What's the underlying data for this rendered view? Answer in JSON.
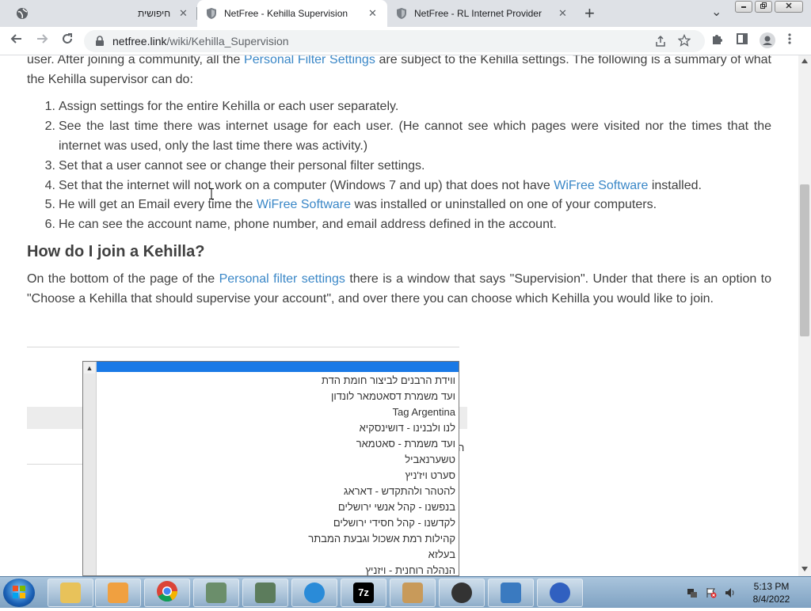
{
  "browser": {
    "tabs": [
      {
        "title": "חיפושית",
        "active": false
      },
      {
        "title": "NetFree - Kehilla Supervision",
        "active": true
      },
      {
        "title": "NetFree - RL Internet Provider",
        "active": false
      }
    ],
    "close_glyph": "✕",
    "new_tab_glyph": "+",
    "tab_search_glyph": "⌄",
    "url_host": "netfree.link",
    "url_path": "/wiki/Kehilla_Supervision"
  },
  "article": {
    "intro_p1": "user. After joining a community, all the ",
    "intro_link": "Personal Filter Settings",
    "intro_p2": " are subject to the Kehilla settings. The following is a summary of what the Kehilla supervisor can do:",
    "list": [
      {
        "num": "1.",
        "pre": "Assign settings for the entire Kehilla or each user separately.",
        "link": "",
        "post": ""
      },
      {
        "num": "2.",
        "pre": "See the last time there was internet usage for each user. (He cannot see which pages were visited nor the times that the internet was used, only the last time there was activity.)",
        "link": "",
        "post": ""
      },
      {
        "num": "3.",
        "pre": "Set that a user cannot see or change their personal filter settings.",
        "link": "",
        "post": ""
      },
      {
        "num": "4.",
        "pre": "Set that the internet will not work on a computer (Windows 7 and up) that does not have ",
        "link": "WiFree Software",
        "post": " installed."
      },
      {
        "num": "5.",
        "pre": "He will get an Email every time the ",
        "link": "WiFree Software",
        "post": " was installed or uninstalled on one of your computers."
      },
      {
        "num": "6.",
        "pre": "He can see the account name, phone number, and email address defined in the account.",
        "link": "",
        "post": ""
      }
    ],
    "heading": "How do I join a Kehilla?",
    "join_p1": "On the bottom of the page of the ",
    "join_link": "Personal filter settings",
    "join_p2": " there is a window that says \"Supervision\". Under that there is an option to \"Choose a Kehilla that should supervise your account\", and over there you can choose which Kehilla you would like to join."
  },
  "listbox": {
    "scroll_up_glyph": "▲",
    "items": [
      "ווידת הרבנים לביצור חומת הדת",
      "ועד משמרת דסאטמאר לונדון",
      "Tag Argentina",
      "לנו ולבנינו - דושינסקיא",
      "ועד משמרת - סאטמאר",
      "טשערנאביל",
      "סערט ויז'ניץ",
      "להטהר ולהתקדש - דאראג",
      "בנפשנו - קהל אנשי ירושלים",
      "לקדשנו - קהל חסידי ירושלים",
      "קהילות רמת אשכול וגבעת המבתר",
      "בעלזא",
      "הנהלה רוחנית - ויזניץ"
    ],
    "side_char": "ה"
  },
  "taskbar": {
    "time": "5:13 PM",
    "date": "8/4/2022",
    "apps": [
      "file-explorer",
      "media-player",
      "chrome",
      "document-viewer",
      "document-viewer-2",
      "internet-explorer",
      "7zip",
      "package-installer",
      "netfree-client",
      "control-panel",
      "netfree-tool"
    ],
    "app_7zip_label": "7z"
  },
  "colors": {
    "link": "#3a87c7",
    "selection": "#1979e6",
    "text": "#404040"
  }
}
